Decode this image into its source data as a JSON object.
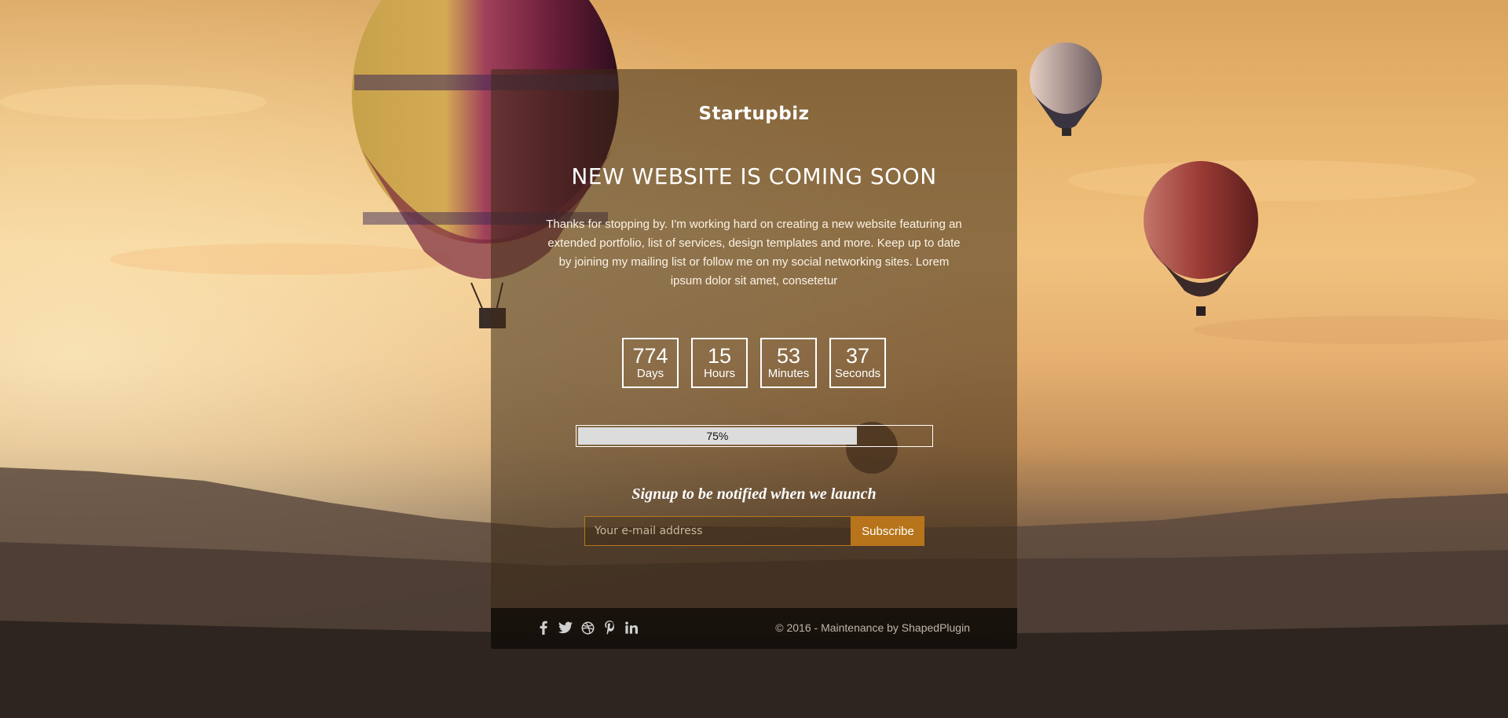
{
  "brand": "Startupbiz",
  "headline": "NEW WEBSITE IS COMING SOON",
  "intro": "Thanks for stopping by. I'm working hard on creating a new website featuring an extended portfolio, list of services, design templates and more. Keep up to date by joining my mailing list or follow me on my social networking sites. Lorem ipsum dolor sit amet, consetetur",
  "countdown": [
    {
      "value": "774",
      "label": "Days"
    },
    {
      "value": "15",
      "label": "Hours"
    },
    {
      "value": "53",
      "label": "Minutes"
    },
    {
      "value": "37",
      "label": "Seconds"
    }
  ],
  "progress": {
    "label": "75%",
    "fraction": 0.79
  },
  "signup": {
    "title": "Signup to be notified when we launch",
    "placeholder": "Your e-mail address",
    "button": "Subscribe"
  },
  "social": [
    "facebook-icon",
    "twitter-icon",
    "dribbble-icon",
    "pinterest-icon",
    "linkedin-icon"
  ],
  "footer": {
    "copyright": "© 2016 - Maintenance by ShapedPlugin"
  },
  "colors": {
    "accent": "#b8741a",
    "card": "rgba(60,42,22,0.55)",
    "footer": "#120e0a"
  }
}
